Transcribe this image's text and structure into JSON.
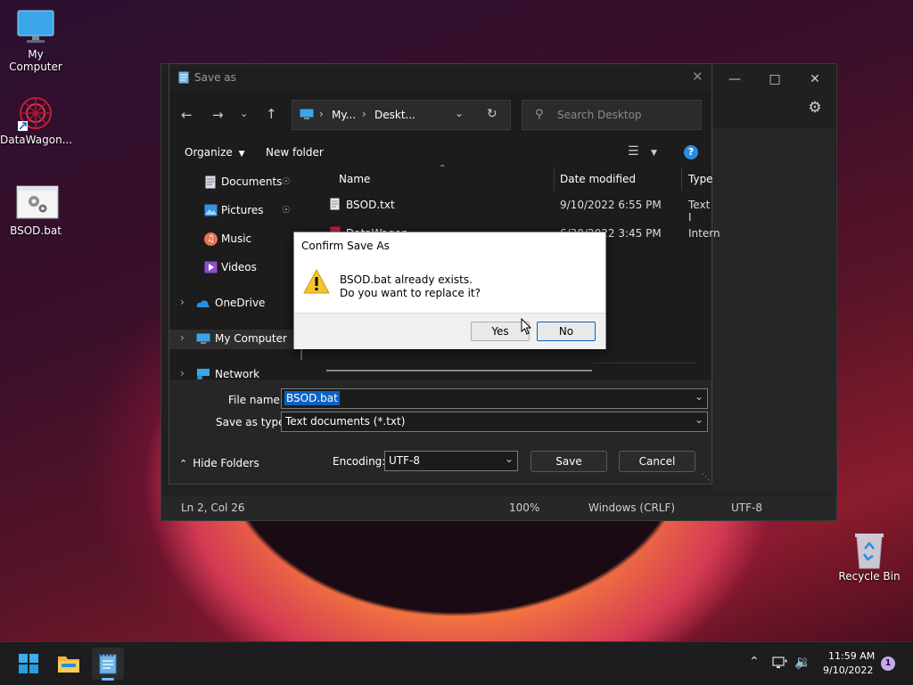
{
  "desktop": {
    "icons": [
      {
        "label": "My Computer"
      },
      {
        "label": "DataWagon..."
      },
      {
        "label": "BSOD.bat"
      },
      {
        "label": "Recycle Bin"
      }
    ]
  },
  "notepad": {
    "status": {
      "position": "Ln 2, Col 26",
      "zoom": "100%",
      "line_ending": "Windows (CRLF)",
      "encoding": "UTF-8"
    }
  },
  "save_as": {
    "title": "Save as",
    "breadcrumb": [
      "My...",
      "Deskt..."
    ],
    "search_placeholder": "Search Desktop",
    "toolbar": {
      "organize": "Organize",
      "new_folder": "New folder"
    },
    "nav": [
      {
        "label": "Documents"
      },
      {
        "label": "Pictures"
      },
      {
        "label": "Music"
      },
      {
        "label": "Videos"
      },
      {
        "label": "OneDrive"
      },
      {
        "label": "My Computer"
      },
      {
        "label": "Network"
      }
    ],
    "columns": {
      "name": "Name",
      "date": "Date modified",
      "type": "Type"
    },
    "files": [
      {
        "name": "BSOD.txt",
        "date": "9/10/2022 6:55 PM",
        "type": "Text I"
      },
      {
        "name": "DataWagon",
        "date": "6/30/2022 3:45 PM",
        "type": "Intern"
      }
    ],
    "file_name_label": "File name:",
    "file_name_value": "BSOD.bat",
    "save_type_label": "Save as type:",
    "save_type_value": "Text documents (*.txt)",
    "hide_folders": "Hide Folders",
    "encoding_label": "Encoding:",
    "encoding_value": "UTF-8",
    "save_button": "Save",
    "cancel_button": "Cancel"
  },
  "confirm": {
    "title": "Confirm Save As",
    "line1": "BSOD.bat already exists.",
    "line2": "Do you want to replace it?",
    "yes": "Yes",
    "no": "No"
  },
  "taskbar": {
    "time": "11:59 AM",
    "date": "9/10/2022",
    "notification_count": "1"
  },
  "colors": {
    "accent": "#3a7bd5",
    "selection": "#0a63c2",
    "taskbar": "#1d1d1f"
  }
}
